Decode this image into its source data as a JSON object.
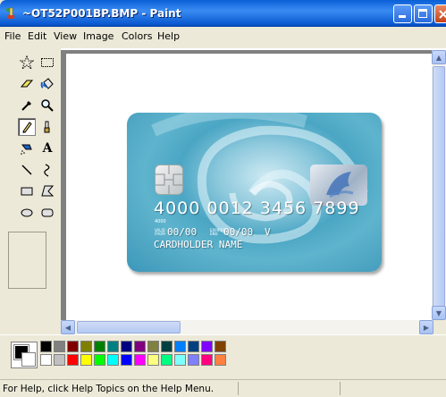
{
  "window": {
    "title": "~OT52P001BP.BMP - Paint",
    "buttons": {
      "minimize": "minimize",
      "maximize": "maximize",
      "close": "close"
    }
  },
  "menu": [
    "File",
    "Edit",
    "View",
    "Image",
    "Colors",
    "Help"
  ],
  "tools": [
    {
      "name": "free-form-select",
      "icon": "star-select-icon"
    },
    {
      "name": "select",
      "icon": "rect-select-icon"
    },
    {
      "name": "eraser",
      "icon": "eraser-icon"
    },
    {
      "name": "fill",
      "icon": "fill-bucket-icon"
    },
    {
      "name": "pick-color",
      "icon": "eyedropper-icon"
    },
    {
      "name": "magnifier",
      "icon": "magnifier-icon"
    },
    {
      "name": "pencil",
      "icon": "pencil-icon",
      "active": true
    },
    {
      "name": "brush",
      "icon": "brush-icon"
    },
    {
      "name": "airbrush",
      "icon": "airbrush-icon"
    },
    {
      "name": "text",
      "icon": "text-icon",
      "glyph": "A"
    },
    {
      "name": "line",
      "icon": "line-icon"
    },
    {
      "name": "curve",
      "icon": "curve-icon"
    },
    {
      "name": "rectangle",
      "icon": "rectangle-icon"
    },
    {
      "name": "polygon",
      "icon": "polygon-icon"
    },
    {
      "name": "ellipse",
      "icon": "ellipse-icon"
    },
    {
      "name": "rounded-rectangle",
      "icon": "rounded-rectangle-icon"
    }
  ],
  "card": {
    "number": "4000 0012 3456 7899",
    "small_digits": "4000",
    "valid_from_label": "VALID FROM",
    "valid_from": "00/00",
    "expires_label": "EXPIRES END",
    "expires": "00/00",
    "v_mark": "V",
    "holder": "CARDHOLDER NAME"
  },
  "palette": {
    "foreground": "#000000",
    "background": "#ffffff",
    "row1": [
      "#000000",
      "#808080",
      "#800000",
      "#808000",
      "#008000",
      "#008080",
      "#000080",
      "#800080",
      "#808040",
      "#004040",
      "#0080ff",
      "#004080",
      "#8000ff",
      "#804000"
    ],
    "row2": [
      "#ffffff",
      "#c0c0c0",
      "#ff0000",
      "#ffff00",
      "#00ff00",
      "#00ffff",
      "#0000ff",
      "#ff00ff",
      "#ffff80",
      "#00ff80",
      "#80ffff",
      "#8080ff",
      "#ff0080",
      "#ff8040"
    ]
  },
  "status": {
    "help_text": "For Help, click Help Topics on the Help Menu."
  }
}
